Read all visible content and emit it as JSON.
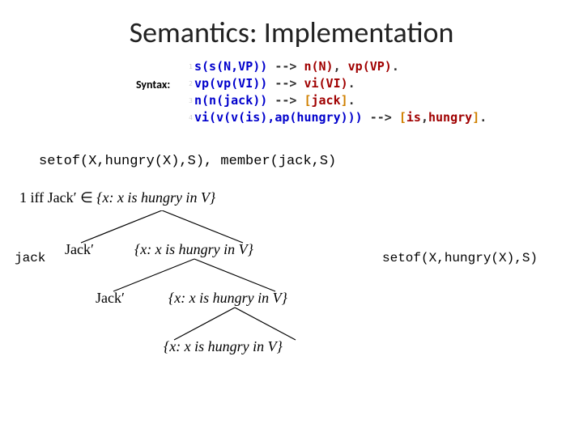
{
  "title": "Semantics: Implementation",
  "syntax_label": "Syntax:",
  "grammar": {
    "lines": [
      {
        "n": "1",
        "head": "s(s(N,VP))",
        "arrow": "-->",
        "rhs": [
          {
            "t": "n(N)",
            "c": "term"
          },
          {
            "t": ", ",
            "c": "op"
          },
          {
            "t": "vp(VP)",
            "c": "term"
          },
          {
            "t": ".",
            "c": "op"
          }
        ]
      },
      {
        "n": "2",
        "head": "vp(vp(VI))",
        "arrow": "-->",
        "rhs": [
          {
            "t": "vi(VI)",
            "c": "term"
          },
          {
            "t": ".",
            "c": "op"
          }
        ]
      },
      {
        "n": "3",
        "head": "n(n(jack))",
        "arrow": "-->",
        "rhs": [
          {
            "t": "[",
            "c": "brack"
          },
          {
            "t": "jack",
            "c": "atom"
          },
          {
            "t": "]",
            "c": "brack"
          },
          {
            "t": ".",
            "c": "op"
          }
        ]
      },
      {
        "n": "4",
        "head": "vi(v(v(is),ap(hungry)))",
        "arrow": "-->",
        "rhs": [
          {
            "t": "[",
            "c": "brack"
          },
          {
            "t": "is",
            "c": "atom"
          },
          {
            "t": ",",
            "c": "op"
          },
          {
            "t": "hungry",
            "c": "atom"
          },
          {
            "t": "]",
            "c": "brack"
          },
          {
            "t": ".",
            "c": "op"
          }
        ]
      }
    ]
  },
  "query": "setof(X,hungry(X),S), member(jack,S)",
  "formula_prefix": "1 iff Jack′ ∈ ",
  "set_expr": "{x: x is hungry in V}",
  "jack_code": "jack",
  "setof_code": "setof(X,hungry(X),S)",
  "tree": {
    "n1_left": "Jack′",
    "n1_right_prefix": "{x: x is hungry in V}",
    "n2_left": "Jack′",
    "n2_right": "{x: x is hungry in V}",
    "n3": "{x: x is hungry in V}"
  }
}
